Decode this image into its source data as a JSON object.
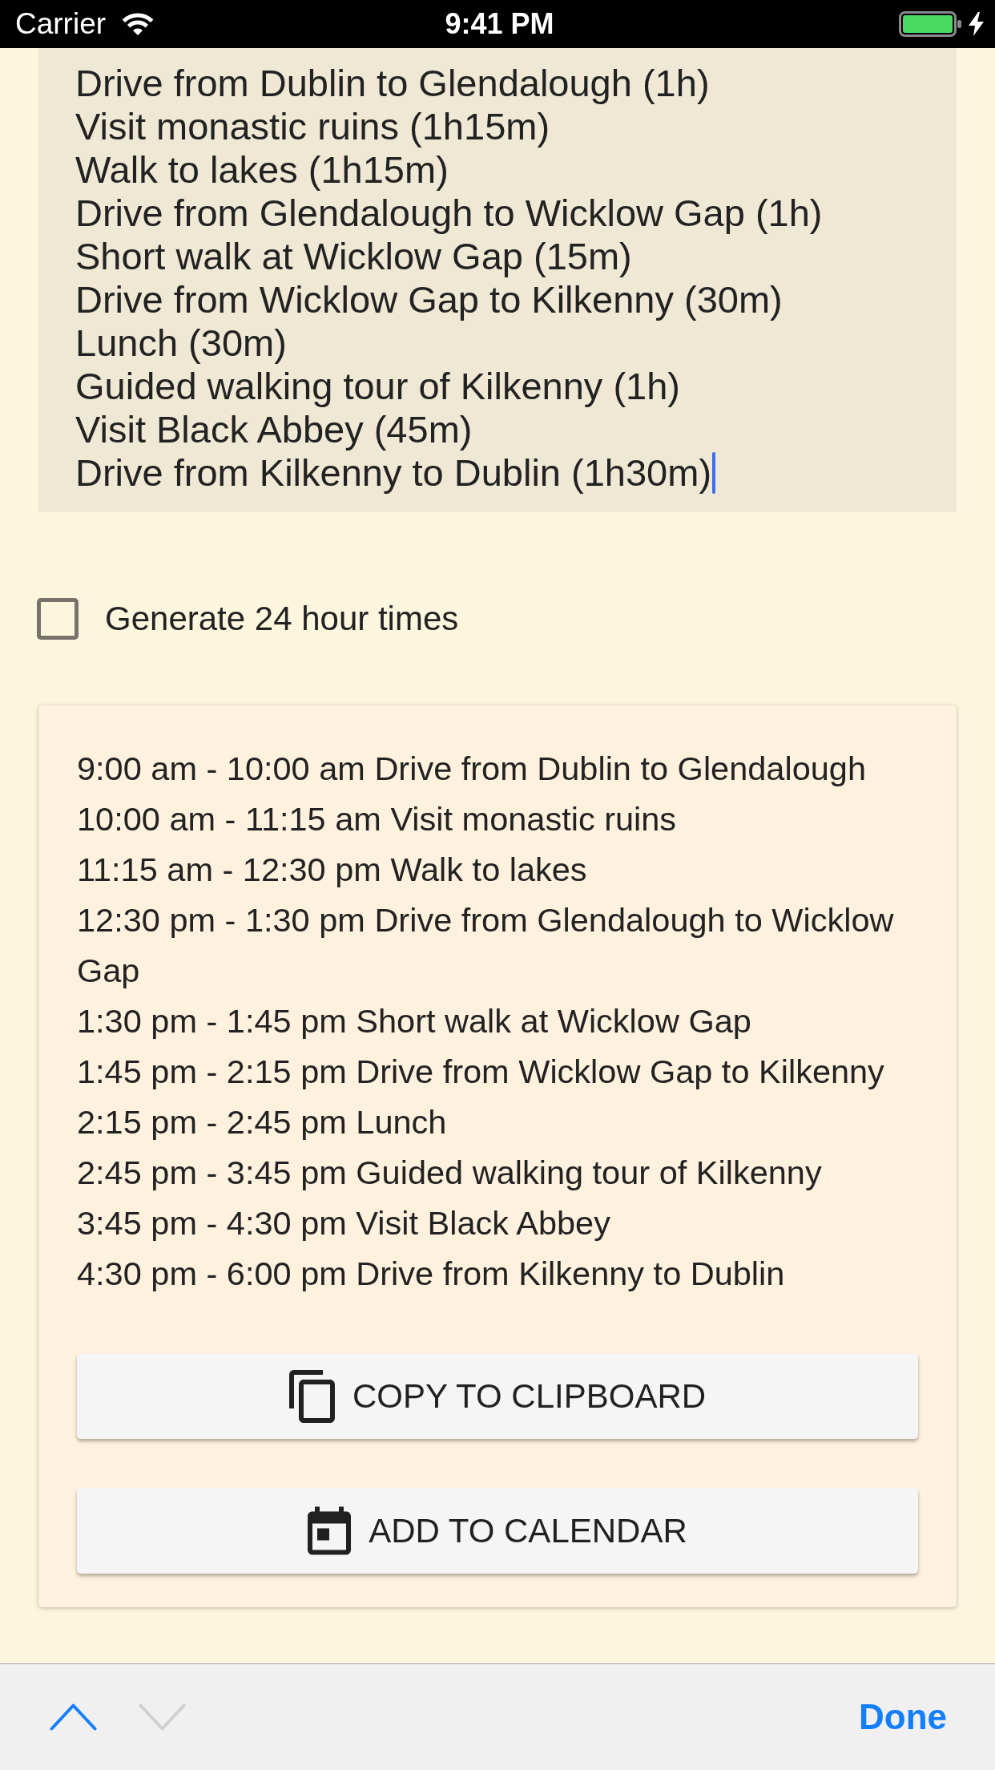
{
  "status_bar": {
    "carrier": "Carrier",
    "time": "9:41 PM"
  },
  "itinerary_field": {
    "focused": true,
    "lines": [
      "Drive from Dublin to Glendalough (1h)",
      "Visit monastic ruins (1h15m)",
      "Walk to lakes (1h15m)",
      "Drive from Glendalough to Wicklow Gap (1h)",
      "Short walk at Wicklow Gap (15m)",
      "Drive from Wicklow Gap to Kilkenny (30m)",
      "Lunch (30m)",
      "Guided walking tour of Kilkenny (1h)",
      "Visit Black Abbey (45m)",
      "Drive from Kilkenny to Dublin (1h30m)"
    ]
  },
  "option": {
    "label": "Generate 24 hour times",
    "checked": false
  },
  "schedule": {
    "lines": [
      "9:00 am - 10:00 am Drive from Dublin to Glendalough",
      "10:00 am - 11:15 am Visit monastic ruins",
      "11:15 am - 12:30 pm Walk to lakes",
      "12:30 pm - 1:30 pm Drive from Glendalough to Wicklow Gap",
      "1:30 pm - 1:45 pm Short walk at Wicklow Gap",
      "1:45 pm - 2:15 pm Drive from Wicklow Gap to Kilkenny",
      "2:15 pm - 2:45 pm Lunch",
      "2:45 pm - 3:45 pm Guided walking tour of Kilkenny",
      "3:45 pm - 4:30 pm Visit Black Abbey",
      "4:30 pm - 6:00 pm Drive from Kilkenny to Dublin"
    ],
    "buttons": [
      {
        "kind": "copy",
        "label": "COPY TO CLIPBOARD"
      },
      {
        "kind": "calendar",
        "label": "ADD TO CALENDAR"
      }
    ]
  },
  "toolbar": {
    "previous": {
      "disabled": false
    },
    "next": {
      "disabled": true
    },
    "done": "Done"
  }
}
